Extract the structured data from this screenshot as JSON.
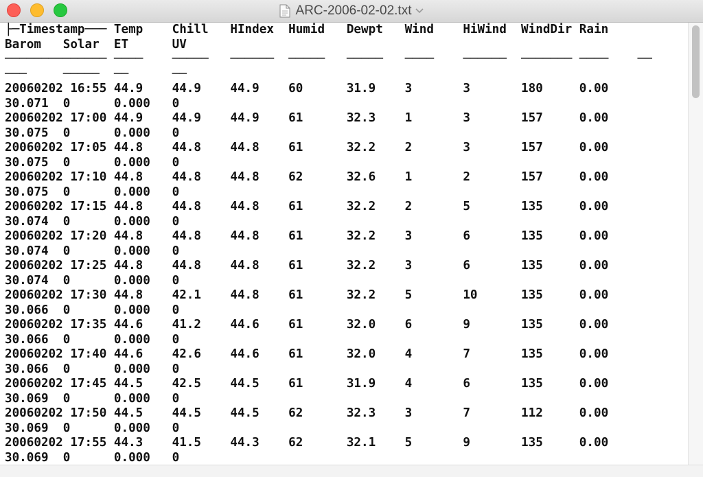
{
  "window": {
    "title": "ARC-2006-02-02.txt"
  },
  "icons": {
    "close": "close-button",
    "minimize": "minimize-button",
    "zoom": "zoom-button",
    "document": "document-icon",
    "title_menu": "chevron-down-icon"
  },
  "colors": {
    "close": "#fd5f57",
    "minimize": "#febc2e",
    "zoom": "#27c840"
  },
  "document": {
    "lines": [
      "├─Timestamp─── Temp    Chill   HIndex  Humid   Dewpt   Wind    HiWind  WindDir Rain",
      "Barom   Solar  ET      UV",
      "────────────── ────    ─────   ──────  ─────   ─────   ────    ──────  ─────── ────    ──",
      "───     ─────  ──      ──",
      "20060202 16:55 44.9    44.9    44.9    60      31.9    3       3       180     0.00",
      "30.071  0      0.000   0",
      "20060202 17:00 44.9    44.9    44.9    61      32.3    1       3       157     0.00",
      "30.075  0      0.000   0",
      "20060202 17:05 44.8    44.8    44.8    61      32.2    2       3       157     0.00",
      "30.075  0      0.000   0",
      "20060202 17:10 44.8    44.8    44.8    62      32.6    1       2       157     0.00",
      "30.075  0      0.000   0",
      "20060202 17:15 44.8    44.8    44.8    61      32.2    2       5       135     0.00",
      "30.074  0      0.000   0",
      "20060202 17:20 44.8    44.8    44.8    61      32.2    3       6       135     0.00",
      "30.074  0      0.000   0",
      "20060202 17:25 44.8    44.8    44.8    61      32.2    3       6       135     0.00",
      "30.074  0      0.000   0",
      "20060202 17:30 44.8    42.1    44.8    61      32.2    5       10      135     0.00",
      "30.066  0      0.000   0",
      "20060202 17:35 44.6    41.2    44.6    61      32.0    6       9       135     0.00",
      "30.066  0      0.000   0",
      "20060202 17:40 44.6    42.6    44.6    61      32.0    4       7       135     0.00",
      "30.066  0      0.000   0",
      "20060202 17:45 44.5    42.5    44.5    61      31.9    4       6       135     0.00",
      "30.069  0      0.000   0",
      "20060202 17:50 44.5    44.5    44.5    62      32.3    3       7       112     0.00",
      "30.069  0      0.000   0",
      "20060202 17:55 44.3    41.5    44.3    62      32.1    5       9       135     0.00",
      "30.069  0      0.000   0"
    ]
  }
}
